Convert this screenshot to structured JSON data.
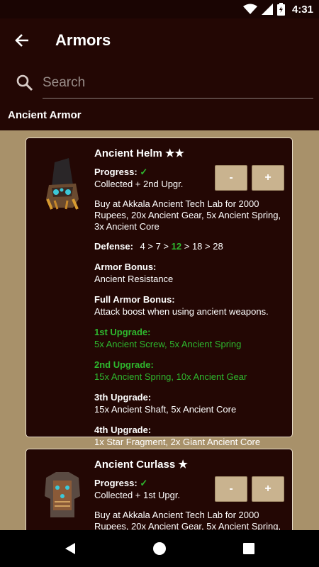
{
  "status": {
    "time": "4:31"
  },
  "app": {
    "title": "Armors",
    "search_placeholder": "Search"
  },
  "section": {
    "title": "Ancient Armor"
  },
  "cards": [
    {
      "name": "Ancient Helm ★★",
      "progress_label": "Progress:",
      "progress_check": "✓",
      "progress_value": "Collected + 2nd Upgr.",
      "minus": "-",
      "plus": "+",
      "description": "Buy at Akkala Ancient Tech Lab for 2000 Rupees, 20x Ancient Gear, 5x Ancient Spring, 3x Ancient Core",
      "defense_label": "Defense:",
      "defense_before": "4 > 7 >",
      "defense_current": "12",
      "defense_after": "> 18 > 28",
      "armor_bonus_label": "Armor Bonus:",
      "armor_bonus": "Ancient Resistance",
      "full_bonus_label": "Full Armor Bonus:",
      "full_bonus": "Attack boost when using ancient weapons.",
      "upgrades": [
        {
          "label": "1st Upgrade:",
          "materials": "5x Ancient Screw, 5x Ancient Spring",
          "done": true
        },
        {
          "label": "2nd Upgrade:",
          "materials": "15x Ancient Spring, 10x Ancient Gear",
          "done": true
        },
        {
          "label": "3th Upgrade:",
          "materials": "15x Ancient Shaft, 5x Ancient Core",
          "done": false
        },
        {
          "label": "4th Upgrade:",
          "materials": "1x Star Fragment, 2x Giant Ancient Core",
          "done": false
        }
      ]
    },
    {
      "name": "Ancient Curlass ★",
      "progress_label": "Progress:",
      "progress_check": "✓",
      "progress_value": "Collected + 1st Upgr.",
      "minus": "-",
      "plus": "+",
      "description": "Buy at Akkala Ancient Tech Lab for 2000 Rupees, 20x Ancient Gear, 5x Ancient Spring,"
    }
  ],
  "colors": {
    "accent_green": "#2eb82e",
    "card_bg": "#230704",
    "page_bg": "#a8916a",
    "button": "#c9b38f"
  },
  "icons": [
    "wifi-icon",
    "signal-icon",
    "battery-icon",
    "back-arrow-icon",
    "search-icon",
    "nav-back-icon",
    "nav-home-icon",
    "nav-recents-icon"
  ]
}
